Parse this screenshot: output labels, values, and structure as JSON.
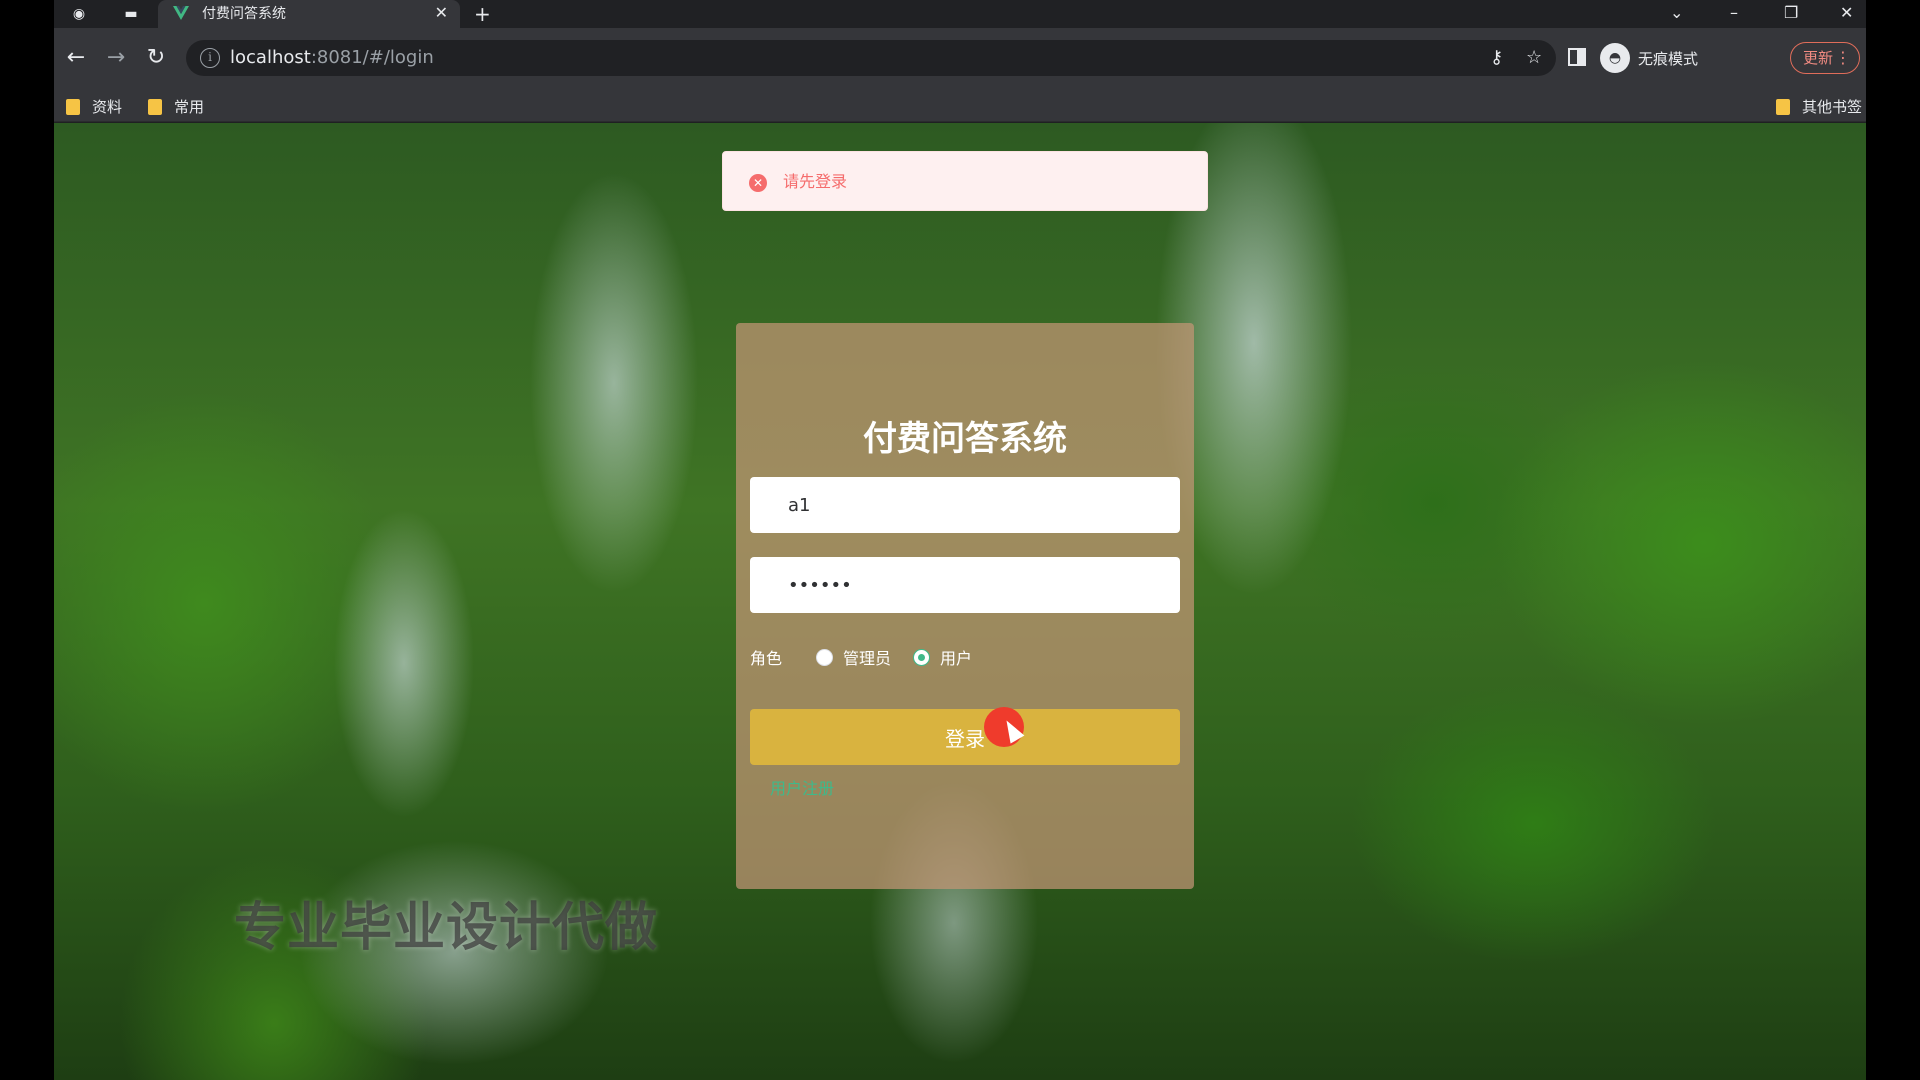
{
  "browser": {
    "tab_title": "付费问答系统",
    "tab_close": "✕",
    "new_tab": "+",
    "url_host": "localhost",
    "url_rest": ":8081/#/login",
    "incognito_label": "无痕模式",
    "update_label": "更新",
    "bookmarks": [
      "资料",
      "常用"
    ],
    "other_bookmarks": "其他书签"
  },
  "toast": {
    "message": "请先登录",
    "color": "#f56c6c"
  },
  "login": {
    "title": "付费问答系统",
    "username_value": "a1",
    "password_value": "••••••",
    "role_label": "角色",
    "roles": [
      "管理员",
      "用户"
    ],
    "selected_role": "用户",
    "submit_label": "登录",
    "register_link": "用户注册",
    "accent": "#3fb98a",
    "button_color": "#d9b33f"
  },
  "watermark": "专业毕业设计代做"
}
